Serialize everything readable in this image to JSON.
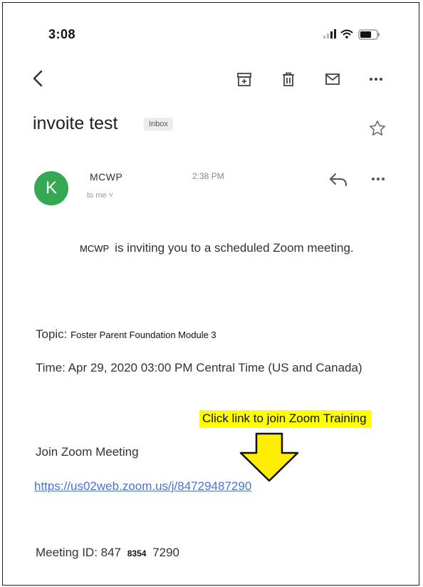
{
  "status_bar": {
    "time": "3:08"
  },
  "email": {
    "subject": "invoite test",
    "label": "Inbox",
    "sender_initial": "K",
    "sender_name": "MCWP",
    "sent_time": "2:38 PM",
    "recipient": "to me ˅"
  },
  "body": {
    "invite_sender": "MCWP",
    "invite_text": "is inviting you to a scheduled Zoom meeting.",
    "topic_label": "Topic:",
    "topic_value": "Foster Parent Foundation Module 3",
    "time_line": "Time: Apr 29, 2020 03:00 PM Central Time (US and Canada)",
    "join_heading": "Join Zoom Meeting",
    "join_link": "https://us02web.zoom.us/j/84729487290",
    "meeting_id_label": "Meeting ID: 847",
    "meeting_id_mid": "8354",
    "meeting_id_end": "7290"
  },
  "annotation": {
    "text": "Click link to join Zoom Training",
    "highlight_color": "#ffff00",
    "arrow_color": "#ffee00"
  },
  "icons": [
    "back-icon",
    "archive-icon",
    "trash-icon",
    "mail-icon",
    "more-icon",
    "star-icon",
    "reply-icon",
    "more-icon",
    "signal-icon",
    "wifi-icon",
    "battery-icon",
    "arrow-down-icon"
  ],
  "colors": {
    "avatar": "#34a853",
    "link": "#4a74c9"
  }
}
